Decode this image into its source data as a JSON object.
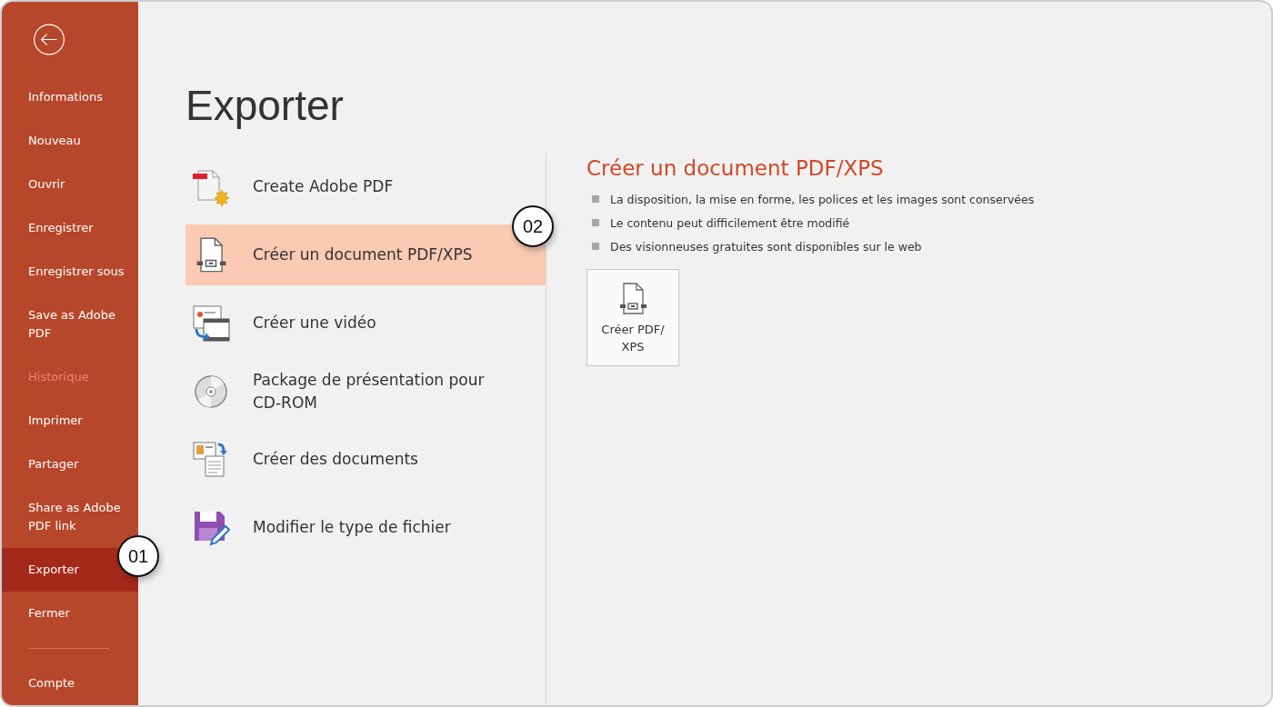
{
  "sidebar": {
    "items": [
      {
        "label": "Informations",
        "selected": false,
        "disabled": false
      },
      {
        "label": "Nouveau",
        "selected": false,
        "disabled": false
      },
      {
        "label": "Ouvrir",
        "selected": false,
        "disabled": false
      },
      {
        "label": "Enregistrer",
        "selected": false,
        "disabled": false
      },
      {
        "label": "Enregistrer sous",
        "selected": false,
        "disabled": false
      },
      {
        "label": "Save as Adobe PDF",
        "selected": false,
        "disabled": false
      },
      {
        "label": "Historique",
        "selected": false,
        "disabled": true
      },
      {
        "label": "Imprimer",
        "selected": false,
        "disabled": false
      },
      {
        "label": "Partager",
        "selected": false,
        "disabled": false
      },
      {
        "label": "Share as Adobe PDF link",
        "selected": false,
        "disabled": false
      },
      {
        "label": "Exporter",
        "selected": true,
        "disabled": false
      },
      {
        "label": "Fermer",
        "selected": false,
        "disabled": false
      }
    ],
    "footer_items": [
      {
        "label": "Compte",
        "selected": false,
        "disabled": false
      }
    ]
  },
  "page_title": "Exporter",
  "options": [
    {
      "kind": "adobe-pdf",
      "label": "Create Adobe PDF",
      "selected": false
    },
    {
      "kind": "pdf-xps",
      "label": "Créer un document PDF/XPS",
      "selected": true
    },
    {
      "kind": "video",
      "label": "Créer une vidéo",
      "selected": false
    },
    {
      "kind": "cd",
      "label": "Package de présentation pour CD-ROM",
      "selected": false
    },
    {
      "kind": "handouts",
      "label": "Créer des documents",
      "selected": false
    },
    {
      "kind": "file-type",
      "label": "Modifier le type de fichier",
      "selected": false
    }
  ],
  "detail": {
    "title": "Créer un document PDF/XPS",
    "bullets": [
      "La disposition, la mise en forme, les polices et les images sont conservées",
      "Le contenu peut difficilement être modifié",
      "Des visionneuses gratuites sont disponibles sur le web"
    ],
    "button": "Créer PDF/ XPS"
  },
  "callouts": [
    {
      "label": "01"
    },
    {
      "label": "02"
    }
  ]
}
